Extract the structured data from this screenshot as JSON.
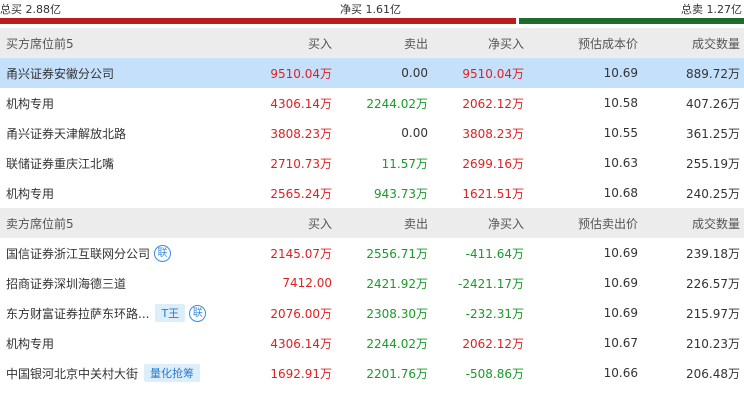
{
  "summary": {
    "buy_label": "总买 2.88亿",
    "net_label": "净买 1.61亿",
    "sell_label": "总卖 1.27亿",
    "buy_fraction": 0.693,
    "colors": {
      "buy": "#b81c1c",
      "sell": "#1f6b2e"
    }
  },
  "buy_section": {
    "headers": [
      "买方席位前5",
      "买入",
      "卖出",
      "净买入",
      "预估成本价",
      "成交数量"
    ],
    "rows": [
      {
        "name": "甬兴证券安徽分公司",
        "buy": "9510.04万",
        "sell": "0.00",
        "net": "9510.04万",
        "price": "10.69",
        "volume": "889.72万",
        "highlight": true
      },
      {
        "name": "机构专用",
        "buy": "4306.14万",
        "sell": "2244.02万",
        "net": "2062.12万",
        "price": "10.58",
        "volume": "407.26万"
      },
      {
        "name": "甬兴证券天津解放北路",
        "buy": "3808.23万",
        "sell": "0.00",
        "net": "3808.23万",
        "price": "10.55",
        "volume": "361.25万"
      },
      {
        "name": "联储证券重庆江北嘴",
        "buy": "2710.73万",
        "sell": "11.57万",
        "net": "2699.16万",
        "price": "10.63",
        "volume": "255.19万"
      },
      {
        "name": "机构专用",
        "buy": "2565.24万",
        "sell": "943.73万",
        "net": "1621.51万",
        "price": "10.68",
        "volume": "240.25万"
      }
    ]
  },
  "sell_section": {
    "headers": [
      "卖方席位前5",
      "买入",
      "卖出",
      "净买入",
      "预估卖出价",
      "成交数量"
    ],
    "rows": [
      {
        "name": "国信证券浙江互联网分公司",
        "badge_circle": "联",
        "buy": "2145.07万",
        "sell": "2556.71万",
        "net": "-411.64万",
        "price": "10.69",
        "volume": "239.18万"
      },
      {
        "name": "招商证券深圳海德三道",
        "buy": "7412.00",
        "sell": "2421.92万",
        "net": "-2421.17万",
        "price": "10.69",
        "volume": "226.57万"
      },
      {
        "name": "东方财富证券拉萨东环路...",
        "badge_rect": "T王",
        "badge_circle": "联",
        "buy": "2076.00万",
        "sell": "2308.30万",
        "net": "-232.31万",
        "price": "10.69",
        "volume": "215.97万"
      },
      {
        "name": "机构专用",
        "buy": "4306.14万",
        "sell": "2244.02万",
        "net": "2062.12万",
        "price": "10.67",
        "volume": "210.23万"
      },
      {
        "name": "中国银河北京中关村大街",
        "badge_rect": "量化抢筹",
        "buy": "1692.91万",
        "sell": "2201.76万",
        "net": "-508.86万",
        "price": "10.66",
        "volume": "206.48万"
      }
    ]
  }
}
